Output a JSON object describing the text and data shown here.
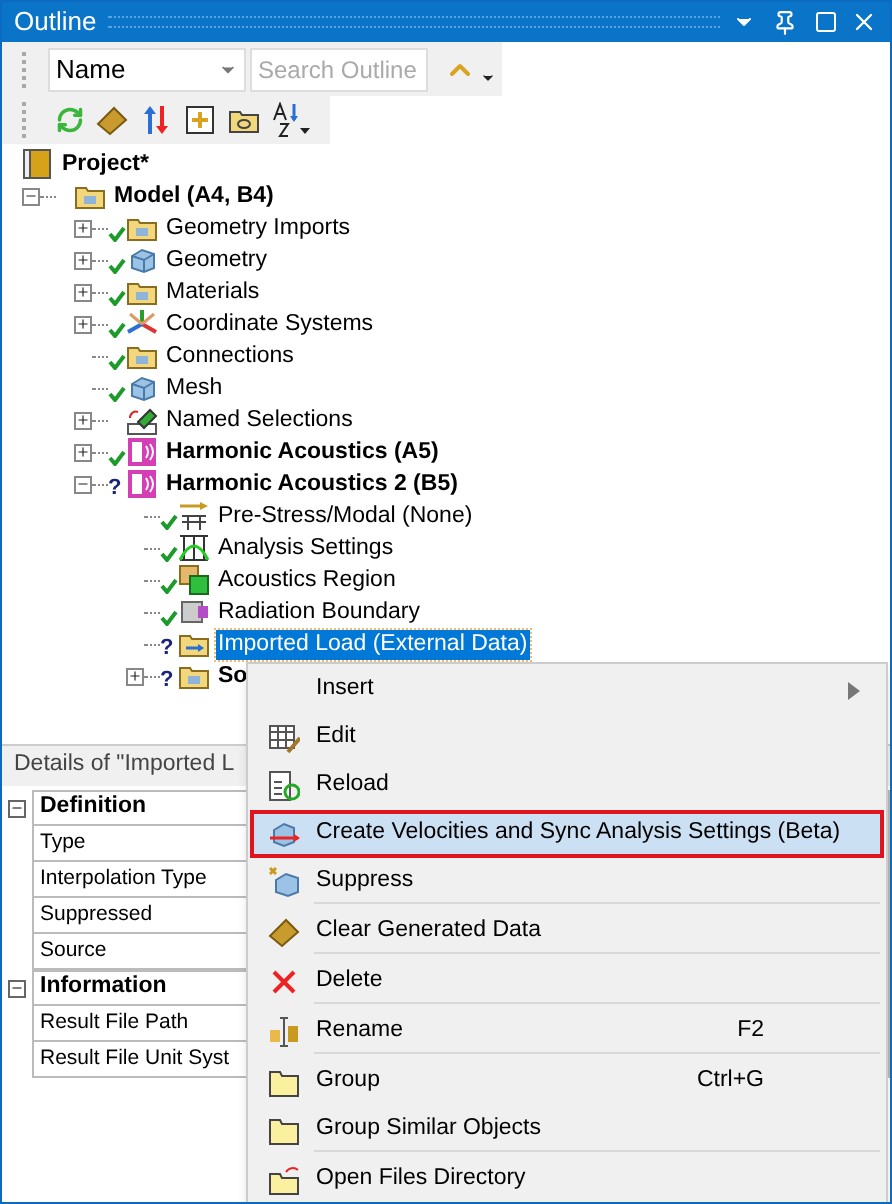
{
  "window": {
    "title": "Outline"
  },
  "toolbar": {
    "filter": {
      "value": "Name"
    },
    "search": {
      "placeholder": "Search Outline"
    }
  },
  "tree": [
    {
      "label": "Project*",
      "bold": true,
      "kind": "project",
      "selected": false,
      "children": [
        {
          "label": "Model (A4, B4)",
          "bold": true,
          "kind": "model",
          "expanded": true,
          "selected": false,
          "children": [
            {
              "label": "Geometry Imports",
              "bold": false,
              "kind": "folder",
              "ok": true,
              "expanded": false,
              "selected": false
            },
            {
              "label": "Geometry",
              "bold": false,
              "kind": "box",
              "ok": true,
              "expanded": false,
              "selected": false
            },
            {
              "label": "Materials",
              "bold": false,
              "kind": "folder",
              "ok": true,
              "expanded": false,
              "selected": false
            },
            {
              "label": "Coordinate Systems",
              "bold": false,
              "kind": "axes",
              "ok": true,
              "expanded": false,
              "selected": false
            },
            {
              "label": "Connections",
              "bold": false,
              "kind": "folder",
              "ok": true,
              "selected": false
            },
            {
              "label": "Mesh",
              "bold": false,
              "kind": "box",
              "ok": true,
              "selected": false
            },
            {
              "label": "Named Selections",
              "bold": false,
              "kind": "named",
              "ok": false,
              "expanded": false,
              "selected": false
            },
            {
              "label": "Harmonic Acoustics (A5)",
              "bold": true,
              "kind": "harmonic",
              "ok": true,
              "expanded": false,
              "selected": false
            },
            {
              "label": "Harmonic Acoustics 2 (B5)",
              "bold": true,
              "kind": "harmonic",
              "ok": false,
              "flag": "?",
              "expanded": true,
              "selected": false,
              "children": [
                {
                  "label": "Pre-Stress/Modal (None)",
                  "bold": false,
                  "kind": "prestress",
                  "ok": true,
                  "selected": false
                },
                {
                  "label": "Analysis Settings",
                  "bold": false,
                  "kind": "grid",
                  "ok": true,
                  "selected": false
                },
                {
                  "label": "Acoustics Region",
                  "bold": false,
                  "kind": "region",
                  "ok": true,
                  "selected": false
                },
                {
                  "label": "Radiation Boundary",
                  "bold": false,
                  "kind": "boundary",
                  "ok": true,
                  "selected": false
                },
                {
                  "label": "Imported Load (External Data)",
                  "bold": false,
                  "kind": "import",
                  "ok": false,
                  "flag": "?",
                  "selected": true
                },
                {
                  "label": "So",
                  "bold": true,
                  "kind": "folder",
                  "ok": false,
                  "flag": "?",
                  "expanded": false,
                  "selected": false
                }
              ]
            }
          ]
        }
      ]
    }
  ],
  "details": {
    "title": "Details of \"Imported L",
    "groups": [
      {
        "label": "Definition",
        "expanded": true,
        "rows": [
          "Type",
          "Interpolation Type",
          "Suppressed",
          "Source"
        ]
      },
      {
        "label": "Information",
        "expanded": true,
        "rows": [
          "Result File Path",
          "Result File Unit Syst"
        ]
      }
    ]
  },
  "context_menu": [
    {
      "label": "Insert",
      "kind": "none",
      "submenu": true,
      "selected": false,
      "divider": false
    },
    {
      "label": "Edit",
      "kind": "table",
      "submenu": false,
      "selected": false,
      "divider": false
    },
    {
      "label": "Reload",
      "kind": "reload",
      "submenu": false,
      "selected": false,
      "divider": false
    },
    {
      "label": "Create Velocities and Sync Analysis Settings (Beta)",
      "kind": "create",
      "submenu": false,
      "selected": true,
      "divider": false
    },
    {
      "label": "Suppress",
      "kind": "suppress",
      "submenu": false,
      "selected": false,
      "divider": true
    },
    {
      "label": "Clear Generated Data",
      "kind": "eraser",
      "submenu": false,
      "selected": false,
      "divider": true
    },
    {
      "label": "Delete",
      "kind": "delete",
      "submenu": false,
      "selected": false,
      "divider": true
    },
    {
      "label": "Rename",
      "kind": "rename",
      "shortcut": "F2",
      "submenu": false,
      "selected": false,
      "divider": true
    },
    {
      "label": "Group",
      "kind": "folder",
      "shortcut": "Ctrl+G",
      "submenu": false,
      "selected": false,
      "divider": false
    },
    {
      "label": "Group Similar Objects",
      "kind": "folder",
      "submenu": false,
      "selected": false,
      "divider": true
    },
    {
      "label": "Open Files Directory",
      "kind": "openfolder",
      "submenu": false,
      "selected": false,
      "divider": false
    }
  ]
}
